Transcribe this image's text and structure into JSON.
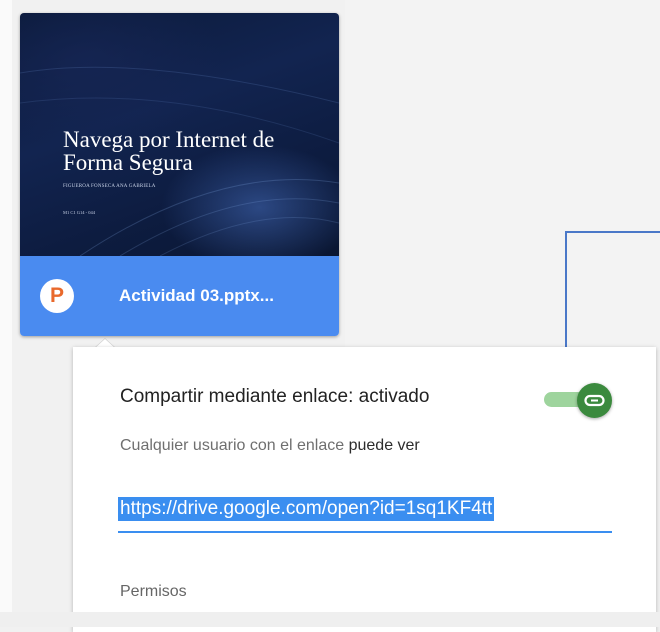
{
  "file_card": {
    "slide_title": "Navega por Internet de Forma Segura",
    "slide_author": "FIGUEROA FONSECA ANA GABRIELA",
    "slide_code": "M1 C1 G14 - 044",
    "file_icon_letter": "P",
    "file_name": "Actividad 03.pptx...",
    "colors": {
      "footer": "#4a8bf0",
      "icon_letter": "#e9692c"
    }
  },
  "share_popup": {
    "title": "Compartir mediante enlace: activado",
    "toggle_on": true,
    "permission_prefix": "Cualquier usuario con el enlace",
    "permission_value": "puede ver",
    "link_url": "https://drive.google.com/open?id=1sq1KF4tt",
    "permissions_heading": "Permisos",
    "colors": {
      "toggle": "#3b8a3e",
      "link_highlight": "#3a8ef0",
      "connector": "#4a78c8"
    }
  }
}
